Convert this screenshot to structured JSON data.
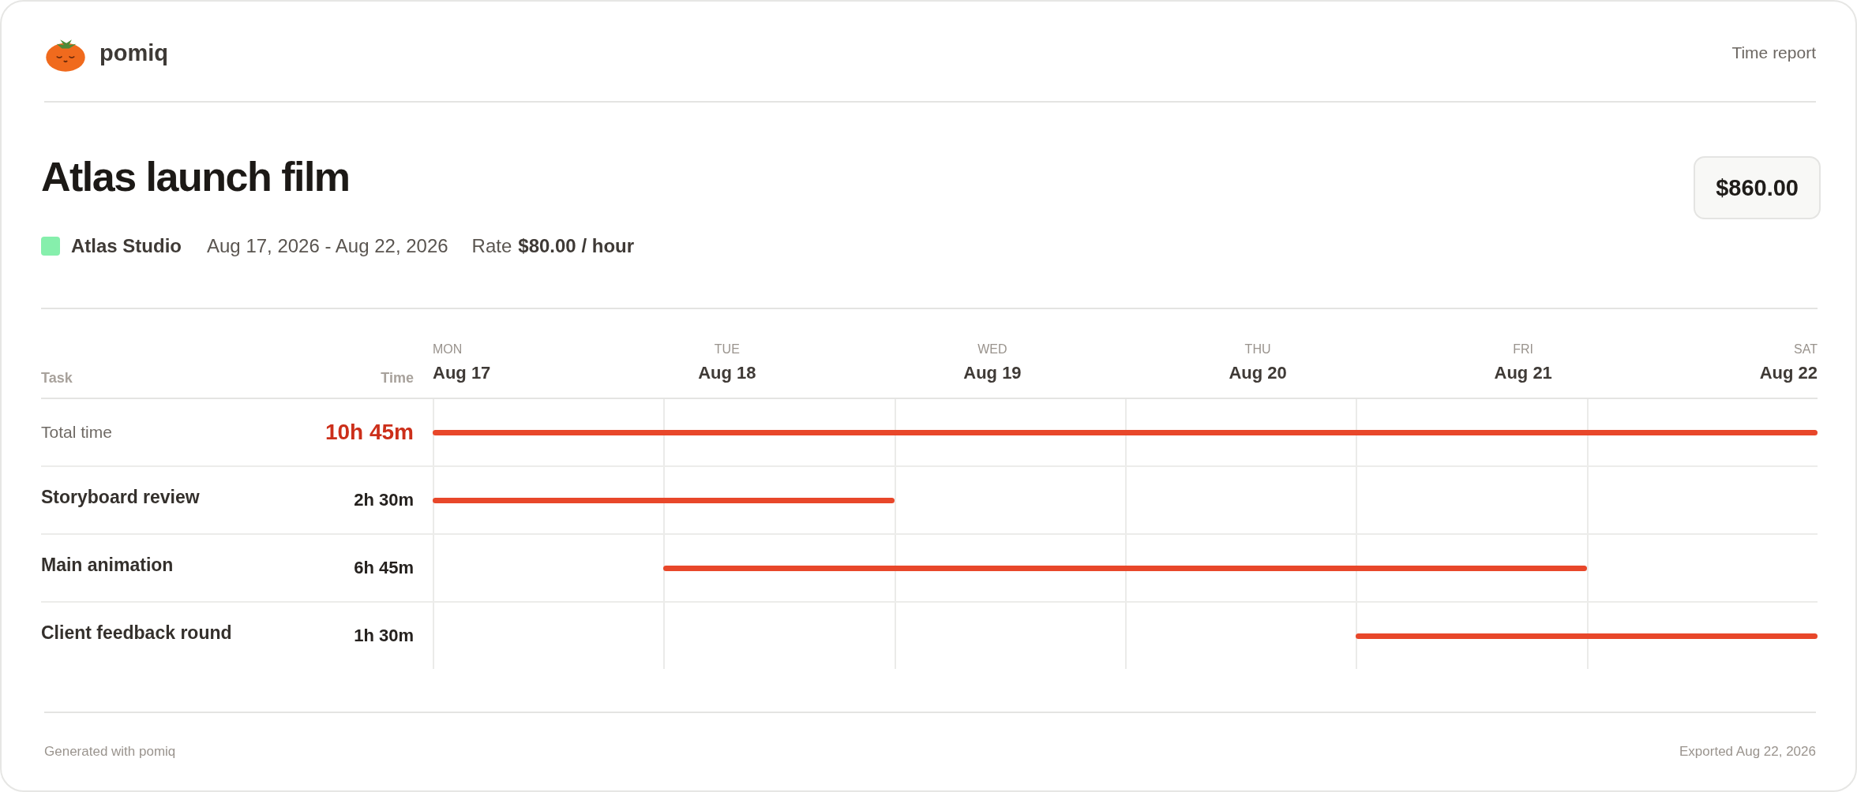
{
  "brand": {
    "name": "pomiq"
  },
  "header": {
    "label": "Time report"
  },
  "project": {
    "title": "Atlas launch film",
    "amount": "$860.00",
    "client": {
      "name": "Atlas Studio",
      "color": "#86efac"
    },
    "dates": "Aug 17, 2026 - Aug 22, 2026",
    "rate_label": "Rate",
    "rate_value": "$80.00 / hour"
  },
  "table": {
    "columns": [
      "Task",
      "Time"
    ],
    "days": [
      {
        "weekday": "MON",
        "date": "Aug 17"
      },
      {
        "weekday": "TUE",
        "date": "Aug 18"
      },
      {
        "weekday": "WED",
        "date": "Aug 19"
      },
      {
        "weekday": "THU",
        "date": "Aug 20"
      },
      {
        "weekday": "FRI",
        "date": "Aug 21"
      },
      {
        "weekday": "SAT",
        "date": "Aug 22"
      }
    ],
    "rows": [
      {
        "kind": "total",
        "task": "Total time",
        "time": "10h 45m",
        "slots": [
          true,
          true,
          true,
          true,
          true,
          true
        ]
      },
      {
        "kind": "task",
        "task": "Storyboard review",
        "time": "2h 30m",
        "slots": [
          true,
          true,
          false,
          false,
          false,
          false
        ]
      },
      {
        "kind": "task",
        "task": "Main animation",
        "time": "6h 45m",
        "slots": [
          false,
          true,
          true,
          true,
          true,
          false
        ]
      },
      {
        "kind": "task",
        "task": "Client feedback round",
        "time": "1h 30m",
        "slots": [
          false,
          false,
          false,
          false,
          true,
          true
        ]
      }
    ]
  },
  "footer": {
    "left": "Generated with pomiq",
    "right": "Exported Aug 22, 2026"
  }
}
